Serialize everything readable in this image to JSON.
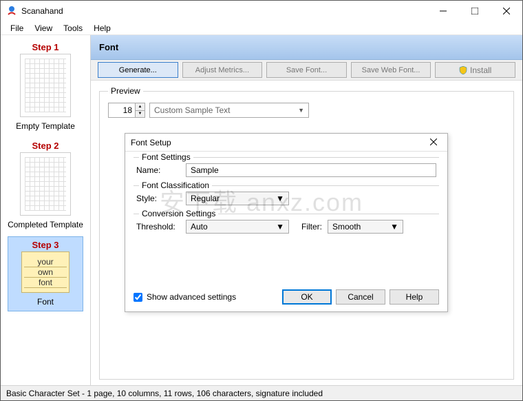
{
  "app": {
    "title": "Scanahand"
  },
  "menubar": [
    "File",
    "View",
    "Tools",
    "Help"
  ],
  "sidebar": {
    "steps": [
      {
        "title": "Step 1",
        "label": "Empty Template"
      },
      {
        "title": "Step 2",
        "label": "Completed Template"
      },
      {
        "title": "Step 3",
        "label": "Font",
        "note": [
          "your",
          "own",
          "font"
        ]
      }
    ]
  },
  "main": {
    "header": "Font",
    "toolbar": {
      "generate": "Generate...",
      "adjust": "Adjust Metrics...",
      "save": "Save Font...",
      "saveweb": "Save Web Font...",
      "install": "Install"
    },
    "preview": {
      "legend": "Preview",
      "size": "18",
      "sample": "Custom Sample Text"
    }
  },
  "dialog": {
    "title": "Font Setup",
    "group1": {
      "title": "Font Settings",
      "name_label": "Name:",
      "name_value": "Sample"
    },
    "group2": {
      "title": "Font Classification",
      "style_label": "Style:",
      "style_value": "Regular"
    },
    "group3": {
      "title": "Conversion Settings",
      "threshold_label": "Threshold:",
      "threshold_value": "Auto",
      "filter_label": "Filter:",
      "filter_value": "Smooth"
    },
    "show_advanced": "Show advanced settings",
    "ok": "OK",
    "cancel": "Cancel",
    "help": "Help"
  },
  "statusbar": "Basic Character Set - 1 page, 10 columns, 11 rows, 106 characters, signature included",
  "watermark": "安下载 anxz.com"
}
